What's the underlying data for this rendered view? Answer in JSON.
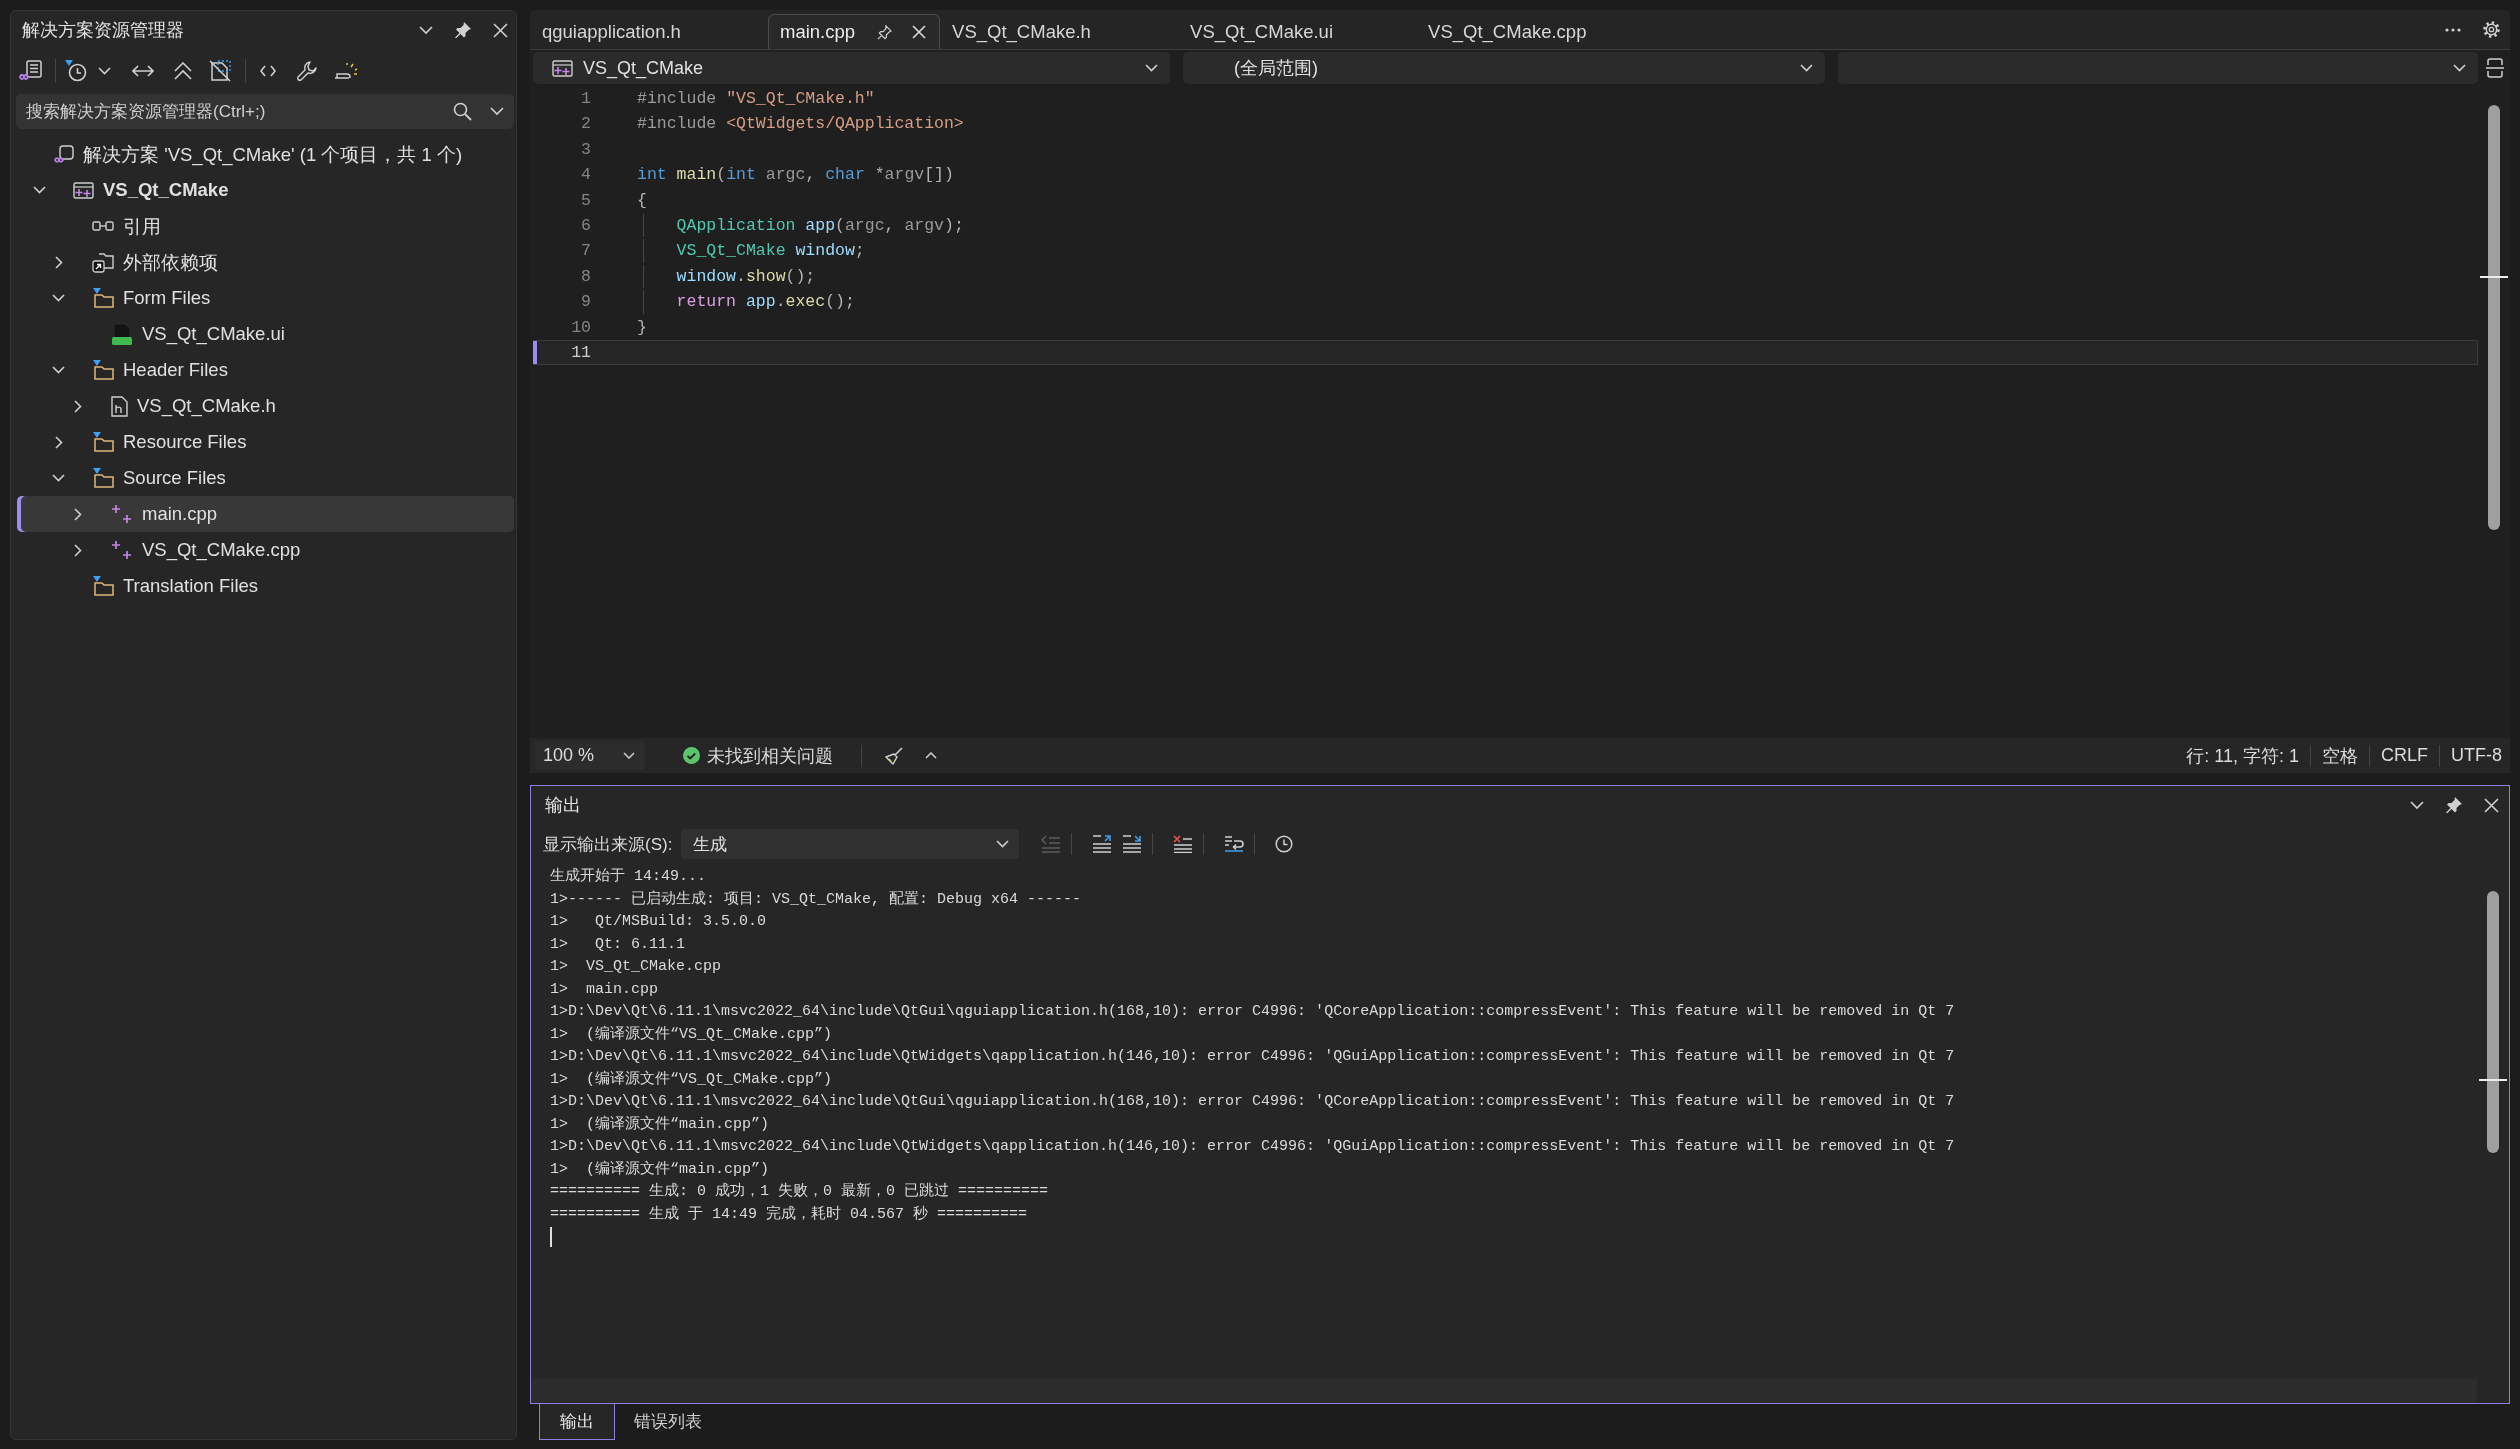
{
  "solution_explorer": {
    "title": "解决方案资源管理器",
    "search": {
      "placeholder": "搜索解决方案资源管理器(Ctrl+;)"
    },
    "tree": [
      {
        "label": "解决方案 'VS_Qt_CMake' (1 个项目，共 1 个)",
        "kind": "solution",
        "selected": false,
        "children": [
          {
            "label": "VS_Qt_CMake",
            "kind": "project",
            "expanded": true,
            "selected": false,
            "children": [
              {
                "label": "引用",
                "kind": "references",
                "selected": false
              },
              {
                "label": "外部依赖项",
                "kind": "external",
                "expanded": false,
                "selected": false
              },
              {
                "label": "Form Files",
                "kind": "folder",
                "expanded": true,
                "selected": false,
                "children": [
                  {
                    "label": "VS_Qt_CMake.ui",
                    "kind": "ui",
                    "selected": false
                  }
                ]
              },
              {
                "label": "Header Files",
                "kind": "folder",
                "expanded": true,
                "selected": false,
                "children": [
                  {
                    "label": "VS_Qt_CMake.h",
                    "kind": "header",
                    "expanded": false,
                    "selected": false
                  }
                ]
              },
              {
                "label": "Resource Files",
                "kind": "folder",
                "expanded": false,
                "selected": false
              },
              {
                "label": "Source Files",
                "kind": "folder",
                "expanded": true,
                "selected": false,
                "children": [
                  {
                    "label": "main.cpp",
                    "kind": "cpp",
                    "expanded": false,
                    "selected": true
                  },
                  {
                    "label": "VS_Qt_CMake.cpp",
                    "kind": "cpp",
                    "expanded": false,
                    "selected": false
                  }
                ]
              },
              {
                "label": "Translation Files",
                "kind": "folder",
                "selected": false
              }
            ]
          }
        ]
      }
    ]
  },
  "editor": {
    "tabs": [
      {
        "label": "qguiapplication.h",
        "selected": false
      },
      {
        "label": "main.cpp",
        "selected": true
      },
      {
        "label": "VS_Qt_CMake.h",
        "selected": false
      },
      {
        "label": "VS_Qt_CMake.ui",
        "selected": false
      },
      {
        "label": "VS_Qt_CMake.cpp",
        "selected": false
      }
    ],
    "nav": {
      "project": "VS_Qt_CMake",
      "scope": "(全局范围)"
    },
    "code_lines": [
      {
        "number": "1",
        "current": false,
        "tokens": [
          {
            "kind": "preprocessor",
            "text": "#include "
          },
          {
            "kind": "string",
            "text": "\"VS_Qt_CMake.h\""
          }
        ]
      },
      {
        "number": "2",
        "current": false,
        "tokens": [
          {
            "kind": "preprocessor",
            "text": "#include "
          },
          {
            "kind": "string",
            "text": "<QtWidgets/QApplication>"
          }
        ]
      },
      {
        "number": "3",
        "current": false
      },
      {
        "number": "4",
        "current": false,
        "tokens": [
          {
            "kind": "keyword",
            "text": "int"
          },
          {
            "kind": "function",
            "text": " main"
          },
          {
            "kind": "punct",
            "text": "("
          },
          {
            "kind": "keyword",
            "text": "int"
          },
          {
            "kind": "param",
            "text": " argc"
          },
          {
            "kind": "punct",
            "text": ", "
          },
          {
            "kind": "keyword",
            "text": "char"
          },
          {
            "kind": "punct",
            "text": " *"
          },
          {
            "kind": "param",
            "text": "argv"
          },
          {
            "kind": "punct",
            "text": "[])"
          }
        ]
      },
      {
        "number": "5",
        "current": false,
        "tokens": [
          {
            "kind": "punct",
            "text": "{"
          }
        ]
      },
      {
        "number": "6",
        "current": false,
        "tokens": [
          {
            "kind": "type",
            "text": "    QApplication"
          },
          {
            "kind": "variable",
            "text": " app"
          },
          {
            "kind": "punct",
            "text": "("
          },
          {
            "kind": "param",
            "text": "argc"
          },
          {
            "kind": "punct",
            "text": ", "
          },
          {
            "kind": "param",
            "text": "argv"
          },
          {
            "kind": "punct",
            "text": ");"
          }
        ]
      },
      {
        "number": "7",
        "current": false,
        "tokens": [
          {
            "kind": "type",
            "text": "    VS_Qt_CMake"
          },
          {
            "kind": "variable",
            "text": " window"
          },
          {
            "kind": "punct",
            "text": ";"
          }
        ]
      },
      {
        "number": "8",
        "current": false,
        "tokens": [
          {
            "kind": "variable",
            "text": "    window"
          },
          {
            "kind": "punct",
            "text": "."
          },
          {
            "kind": "function",
            "text": "show"
          },
          {
            "kind": "punct",
            "text": "();"
          }
        ]
      },
      {
        "number": "9",
        "current": false,
        "tokens": [
          {
            "kind": "control",
            "text": "    return"
          },
          {
            "kind": "variable",
            "text": " app"
          },
          {
            "kind": "punct",
            "text": "."
          },
          {
            "kind": "function",
            "text": "exec"
          },
          {
            "kind": "punct",
            "text": "();"
          }
        ]
      },
      {
        "number": "10",
        "current": false,
        "tokens": [
          {
            "kind": "punct",
            "text": "}"
          }
        ]
      },
      {
        "number": "11",
        "current": true
      }
    ],
    "status": {
      "zoom": "100 %",
      "issues": "未找到相关问题",
      "position": "行: 11, 字符: 1",
      "indentation": "空格",
      "line_ending": "CRLF",
      "encoding": "UTF-8"
    }
  },
  "output": {
    "title": "输出",
    "source_label": "显示输出来源(S):",
    "source": "生成",
    "tools": [
      {
        "kind": "find",
        "disabled": true
      },
      {
        "kind": "previous",
        "disabled": false
      },
      {
        "kind": "next",
        "disabled": false
      },
      {
        "kind": "clear",
        "disabled": false
      },
      {
        "kind": "wrap",
        "disabled": false
      },
      {
        "kind": "timestamp",
        "disabled": false
      }
    ],
    "lines": [
      "生成开始于 14:49...",
      "1>------ 已启动生成: 项目: VS_Qt_CMake, 配置: Debug x64 ------",
      "1>   Qt/MSBuild: 3.5.0.0",
      "1>   Qt: 6.11.1",
      "1>  VS_Qt_CMake.cpp",
      "1>  main.cpp",
      "1>D:\\Dev\\Qt\\6.11.1\\msvc2022_64\\include\\QtGui\\qguiapplication.h(168,10): error C4996: 'QCoreApplication::compressEvent': This feature will be removed in Qt 7",
      "1>  (编译源文件“VS_Qt_CMake.cpp”)",
      "1>D:\\Dev\\Qt\\6.11.1\\msvc2022_64\\include\\QtWidgets\\qapplication.h(146,10): error C4996: 'QGuiApplication::compressEvent': This feature will be removed in Qt 7",
      "1>  (编译源文件“VS_Qt_CMake.cpp”)",
      "1>D:\\Dev\\Qt\\6.11.1\\msvc2022_64\\include\\QtGui\\qguiapplication.h(168,10): error C4996: 'QCoreApplication::compressEvent': This feature will be removed in Qt 7",
      "1>  (编译源文件“main.cpp”)",
      "1>D:\\Dev\\Qt\\6.11.1\\msvc2022_64\\include\\QtWidgets\\qapplication.h(146,10): error C4996: 'QGuiApplication::compressEvent': This feature will be removed in Qt 7",
      "1>  (编译源文件“main.cpp”)",
      "========== 生成: 0 成功，1 失败，0 最新，0 已跳过 ==========",
      "========== 生成 于 14:49 完成，耗时 04.567 秒 =========="
    ]
  },
  "bottom_tabs": [
    {
      "label": "输出",
      "selected": true
    },
    {
      "label": "错误列表",
      "selected": false
    }
  ]
}
